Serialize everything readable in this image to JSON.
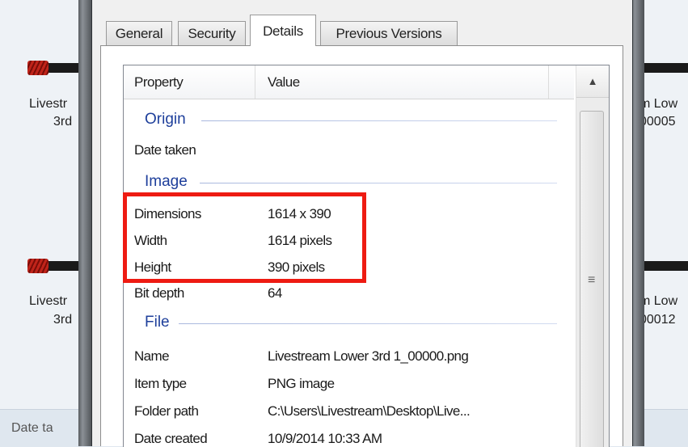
{
  "background_window": {
    "items_left": [
      {
        "line1": "Livestr",
        "line2": "3rd"
      },
      {
        "line1": "Livestr",
        "line2": "3rd"
      }
    ],
    "items_right": [
      {
        "line1": "m Low",
        "line2": "00005"
      },
      {
        "line1": "m Low",
        "line2": "00012"
      }
    ],
    "status_text": "Date ta"
  },
  "dialog": {
    "tabs": [
      {
        "label": "General",
        "active": false
      },
      {
        "label": "Security",
        "active": false
      },
      {
        "label": "Details",
        "active": true
      },
      {
        "label": "Previous Versions",
        "active": false
      }
    ],
    "columns": {
      "property": "Property",
      "value": "Value"
    },
    "groups": {
      "origin": "Origin",
      "image": "Image",
      "file": "File"
    },
    "rows": {
      "date_taken": {
        "property": "Date taken",
        "value": ""
      },
      "dimensions": {
        "property": "Dimensions",
        "value": "1614 x 390"
      },
      "width": {
        "property": "Width",
        "value": "1614 pixels"
      },
      "height": {
        "property": "Height",
        "value": "390 pixels"
      },
      "bit_depth": {
        "property": "Bit depth",
        "value": "64"
      },
      "name": {
        "property": "Name",
        "value": "Livestream Lower 3rd 1_00000.png"
      },
      "item_type": {
        "property": "Item type",
        "value": "PNG image"
      },
      "folder_path": {
        "property": "Folder path",
        "value": "C:\\Users\\Livestream\\Desktop\\Live..."
      },
      "date_created": {
        "property": "Date created",
        "value": "10/9/2014 10:33 AM"
      }
    }
  },
  "colors": {
    "highlight_box": "#ee1b12",
    "group_header": "#1e3f9b"
  },
  "icons": {
    "scroll_up": "scroll-up-arrow-icon",
    "scroll_grip": "scroll-grip-icon"
  }
}
